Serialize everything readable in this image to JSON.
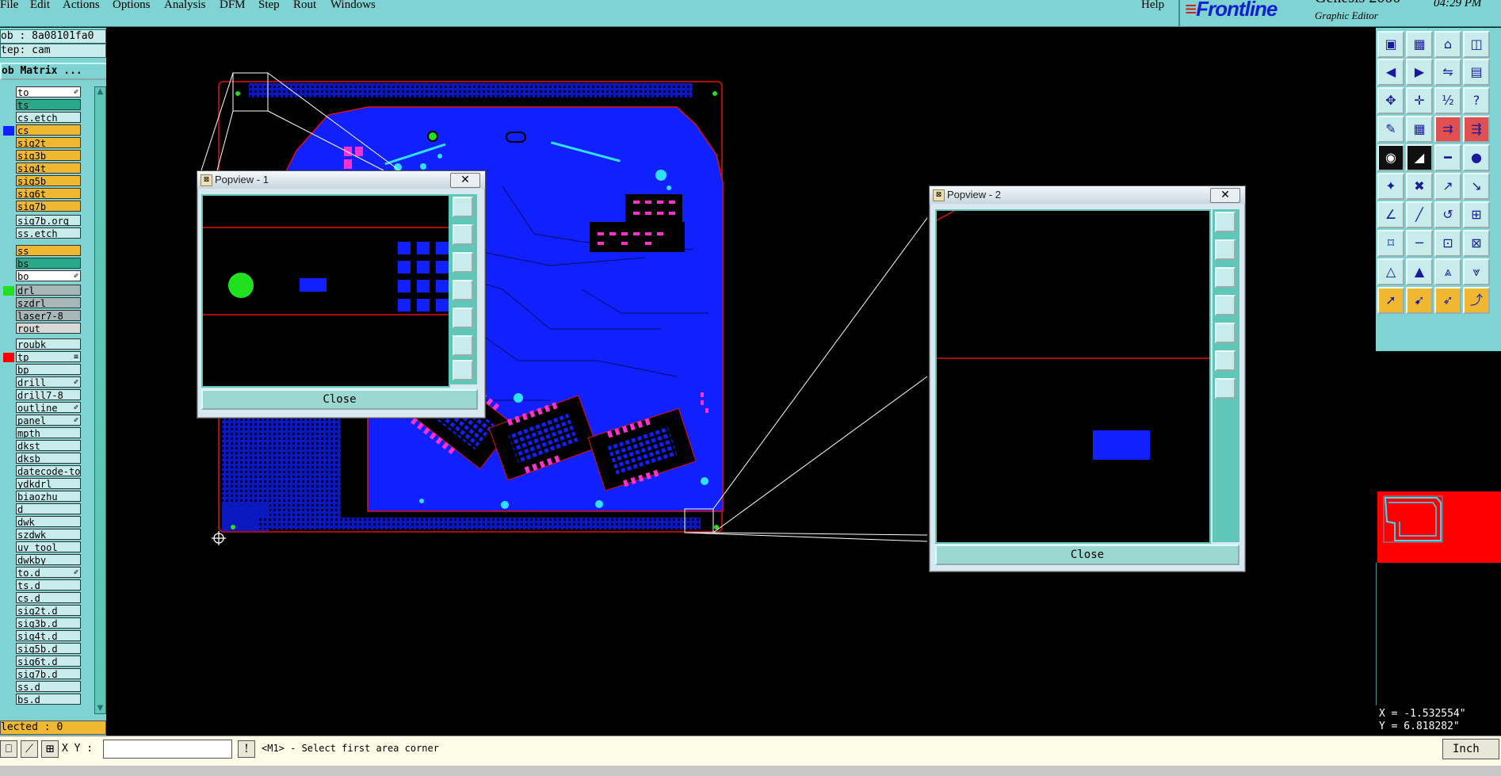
{
  "menubar": {
    "items": [
      "File",
      "Edit",
      "Actions",
      "Options",
      "Analysis",
      "DFM",
      "Step",
      "Rout",
      "Windows"
    ],
    "help": "Help"
  },
  "brand": {
    "logo": "Frontline",
    "product": "Genesis 2000",
    "subtitle": "Graphic Editor",
    "time": "04:29 PM"
  },
  "job": {
    "job_label": "ob : 8a08101fa0",
    "step_label": "tep: cam",
    "matrix_button": "ob Matrix ..."
  },
  "layers": [
    {
      "name": "to",
      "bg": "#ffffff",
      "swatch": "",
      "mark": "✐"
    },
    {
      "name": "ts",
      "bg": "#2aa88a",
      "swatch": "",
      "mark": ""
    },
    {
      "name": "cs.etch",
      "bg": "#c8ecec",
      "swatch": "",
      "mark": ""
    },
    {
      "name": "cs",
      "bg": "#f0b830",
      "swatch": "#1020ff",
      "mark": ""
    },
    {
      "name": "sig2t",
      "bg": "#f0b830",
      "swatch": "",
      "mark": ""
    },
    {
      "name": "sig3b",
      "bg": "#f0b830",
      "swatch": "",
      "mark": ""
    },
    {
      "name": "sig4t",
      "bg": "#f0b830",
      "swatch": "",
      "mark": ""
    },
    {
      "name": "sig5b",
      "bg": "#f0b830",
      "swatch": "",
      "mark": ""
    },
    {
      "name": "sig6t",
      "bg": "#f0b830",
      "swatch": "",
      "mark": ""
    },
    {
      "name": "sig7b",
      "bg": "#f0b830",
      "swatch": "",
      "mark": ""
    },
    {
      "name": "sig7b.org",
      "bg": "#c8ecec",
      "swatch": "",
      "mark": ""
    },
    {
      "name": "ss.etch",
      "bg": "#c8ecec",
      "swatch": "",
      "mark": ""
    },
    {
      "name": "ss",
      "bg": "#f0b830",
      "swatch": "",
      "mark": ""
    },
    {
      "name": "bs",
      "bg": "#2aa88a",
      "swatch": "",
      "mark": ""
    },
    {
      "name": "bo",
      "bg": "#ffffff",
      "swatch": "",
      "mark": "✐"
    },
    {
      "name": "drl",
      "bg": "#a8b8b8",
      "swatch": "#20e020",
      "mark": ""
    },
    {
      "name": "szdrl",
      "bg": "#a8b8b8",
      "swatch": "",
      "mark": ""
    },
    {
      "name": "laser7-8",
      "bg": "#a8b8b8",
      "swatch": "",
      "mark": ""
    },
    {
      "name": "rout",
      "bg": "#d8d8d8",
      "swatch": "",
      "mark": ""
    },
    {
      "name": "roubk",
      "bg": "#c8ecec",
      "swatch": "",
      "mark": ""
    },
    {
      "name": "tp",
      "bg": "#c8ecec",
      "swatch": "#ff0000",
      "mark": "≡"
    },
    {
      "name": "bp",
      "bg": "#c8ecec",
      "swatch": "",
      "mark": ""
    },
    {
      "name": "drill",
      "bg": "#c8ecec",
      "swatch": "",
      "mark": "✐"
    },
    {
      "name": "drill7-8",
      "bg": "#c8ecec",
      "swatch": "",
      "mark": ""
    },
    {
      "name": "outline",
      "bg": "#c8ecec",
      "swatch": "",
      "mark": "✐"
    },
    {
      "name": "panel",
      "bg": "#c8ecec",
      "swatch": "",
      "mark": "✐"
    },
    {
      "name": "mpth",
      "bg": "#c8ecec",
      "swatch": "",
      "mark": ""
    },
    {
      "name": "dkst",
      "bg": "#c8ecec",
      "swatch": "",
      "mark": ""
    },
    {
      "name": "dksb",
      "bg": "#c8ecec",
      "swatch": "",
      "mark": ""
    },
    {
      "name": "datecode-to",
      "bg": "#c8ecec",
      "swatch": "",
      "mark": ""
    },
    {
      "name": "ydkdrl",
      "bg": "#c8ecec",
      "swatch": "",
      "mark": ""
    },
    {
      "name": "biaozhu",
      "bg": "#c8ecec",
      "swatch": "",
      "mark": ""
    },
    {
      "name": "d",
      "bg": "#c8ecec",
      "swatch": "",
      "mark": ""
    },
    {
      "name": "dwk",
      "bg": "#c8ecec",
      "swatch": "",
      "mark": ""
    },
    {
      "name": "szdwk",
      "bg": "#c8ecec",
      "swatch": "",
      "mark": ""
    },
    {
      "name": "uv_tool",
      "bg": "#c8ecec",
      "swatch": "",
      "mark": ""
    },
    {
      "name": "dwkby",
      "bg": "#c8ecec",
      "swatch": "",
      "mark": ""
    },
    {
      "name": "to.d",
      "bg": "#c8ecec",
      "swatch": "",
      "mark": "✐"
    },
    {
      "name": "ts.d",
      "bg": "#c8ecec",
      "swatch": "",
      "mark": ""
    },
    {
      "name": "cs.d",
      "bg": "#c8ecec",
      "swatch": "",
      "mark": ""
    },
    {
      "name": "sig2t.d",
      "bg": "#c8ecec",
      "swatch": "",
      "mark": ""
    },
    {
      "name": "sig3b.d",
      "bg": "#c8ecec",
      "swatch": "",
      "mark": ""
    },
    {
      "name": "sig4t.d",
      "bg": "#c8ecec",
      "swatch": "",
      "mark": ""
    },
    {
      "name": "sig5b.d",
      "bg": "#c8ecec",
      "swatch": "",
      "mark": ""
    },
    {
      "name": "sig6t.d",
      "bg": "#c8ecec",
      "swatch": "",
      "mark": ""
    },
    {
      "name": "sig7b.d",
      "bg": "#c8ecec",
      "swatch": "",
      "mark": ""
    },
    {
      "name": "ss.d",
      "bg": "#c8ecec",
      "swatch": "",
      "mark": ""
    },
    {
      "name": "bs.d",
      "bg": "#c8ecec",
      "swatch": "",
      "mark": ""
    }
  ],
  "selected": "lected : 0",
  "popview1": {
    "title": "Popview - 1",
    "close_x": "✕",
    "close_button": "Close"
  },
  "popview2": {
    "title": "Popview - 2",
    "close_x": "✕",
    "close_button": "Close"
  },
  "coords": {
    "x": "X = -1.532554\"",
    "y": "Y = 6.818282\""
  },
  "bottom": {
    "xy_label": "X Y :",
    "xy_value": "",
    "status": "<M1> - Select first area corner",
    "units": "Inch"
  },
  "colors": {
    "panel_bg": "#7fd3d3",
    "board_fill": "#1020ff",
    "outline_red": "#e01010",
    "drill_green": "#20e020",
    "pad_magenta": "#ff30d0",
    "via_cyan": "#30e0ff"
  }
}
